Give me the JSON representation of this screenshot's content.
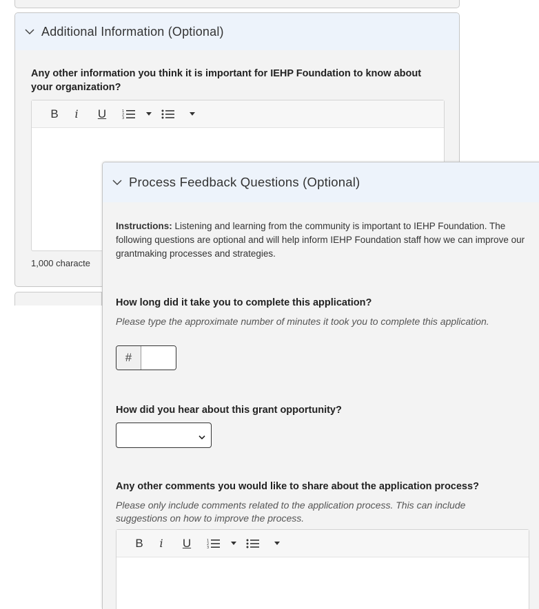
{
  "panel_additional": {
    "title": "Additional Information (Optional)",
    "question": "Any other information you think it is important for IEHP Foundation to know about your organization?",
    "counter": "1,000 characte"
  },
  "panel_feedback": {
    "title": "Process Feedback Questions (Optional)",
    "instructions_label": "Instructions:",
    "instructions_text": " Listening and learning from the community is important to IEHP Foundation. The following questions are optional and will help inform IEHP Foundation staff how we can improve our grantmaking processes and strategies.",
    "q1": {
      "label": "How long did it take you to complete this application?",
      "hint": "Please type the approximate number of minutes it took you to complete this application.",
      "prefix": "#",
      "value": ""
    },
    "q2": {
      "label": "How did you hear about this grant opportunity?",
      "selected": ""
    },
    "q3": {
      "label": "Any other comments you would like to share about the application process?",
      "hint": "Please only include comments related to the application process. This can include suggestions on how to improve the process."
    }
  },
  "toolbar": {
    "bold": "B",
    "italic": "i",
    "underline": "U"
  }
}
